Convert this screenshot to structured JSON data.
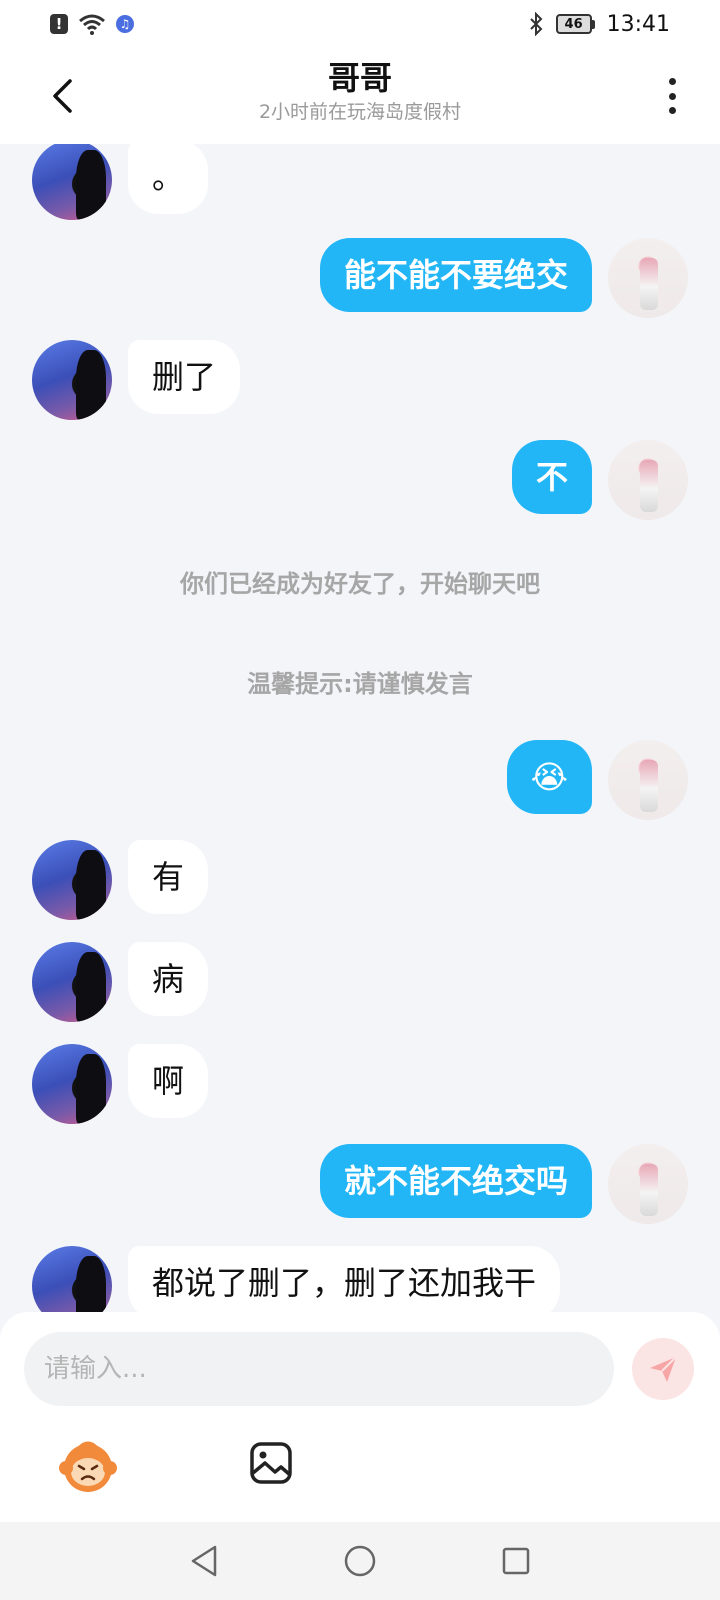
{
  "status_bar": {
    "time": "13:41",
    "battery": "46",
    "icons": [
      "alert-icon",
      "wifi-icon",
      "music-icon",
      "bluetooth-icon",
      "battery-icon"
    ]
  },
  "header": {
    "title": "哥哥",
    "subtitle": "2小时前在玩海岛度假村",
    "back_icon": "chevron-left-icon",
    "more_icon": "more-vertical-icon"
  },
  "messages": [
    {
      "side": "in",
      "text": "。"
    },
    {
      "side": "out",
      "text": "能不能不要绝交"
    },
    {
      "side": "in",
      "text": "删了"
    },
    {
      "side": "out",
      "text": "不"
    },
    {
      "side": "system",
      "text": "你们已经成为好友了，开始聊天吧"
    },
    {
      "side": "system",
      "text": "温馨提示:请谨慎发言"
    },
    {
      "side": "out",
      "text": "😭"
    },
    {
      "side": "in",
      "text": "有"
    },
    {
      "side": "in",
      "text": "病"
    },
    {
      "side": "in",
      "text": "啊"
    },
    {
      "side": "out",
      "text": "就不能不绝交吗"
    },
    {
      "side": "in",
      "text": "都说了删了，删了还加我干"
    }
  ],
  "input": {
    "placeholder": "请输入...",
    "value": ""
  },
  "toolbar": {
    "send_icon": "send-icon",
    "emoji_icon": "emoji-sticker-icon",
    "image_icon": "image-icon"
  },
  "colors": {
    "out_bubble": "#22b6f7",
    "in_bubble": "#ffffff",
    "background": "#f3f5f9",
    "send_button": "#fbe4e4"
  }
}
